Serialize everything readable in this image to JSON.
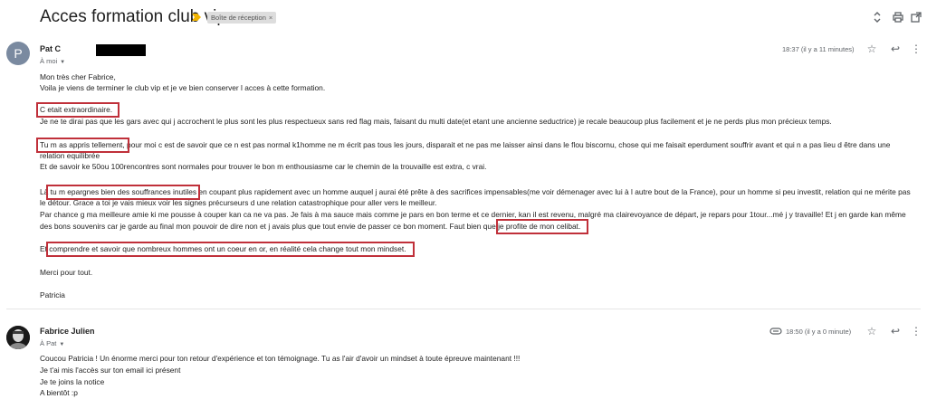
{
  "subject": {
    "title": "Acces formation club vip",
    "label": "Boîte de réception",
    "label_close": "×"
  },
  "toolbar": {
    "expand_icon": "⇳",
    "print_icon": "⎙",
    "open_icon": "⧉"
  },
  "message1": {
    "avatar_letter": "P",
    "sender": "Pat C",
    "recipient": "À moi",
    "time": "18:37 (il y a 11 minutes)",
    "lines": [
      "Mon très cher Fabrice,",
      "Voila je viens de terminer le club vip et je ve bien conserver l acces à cette formation.",
      "C etait extraordinaire.",
      "Je ne te dirai pas que les gars avec qui j accrochent le plus sont les plus respectueux sans red flag mais, faisant du multi date(et etant une ancienne seductrice) je recale beaucoup plus facilement et je ne perds plus mon précieux temps.",
      "Tu m as appris tellement, pour moi c est de savoir que ce n est pas normal k1homme ne m écrit pas tous les jours, disparait et ne pas me laisser ainsi dans le flou biscornu, chose qui me faisait eperdument souffrir avant et qui n a pas lieu d être dans une",
      "relation equilibrée",
      "Et de savoir ke 50ou 100rencontres sont normales pour trouver le bon m enthousiasme car le chemin de la trouvaille est extra, c vrai.",
      "Là tu m epargnes bien des souffrances inutiles en coupant plus rapidement avec un homme auquel j aurai été prête à des sacrifices impensables(me voir démenager avec lui à l autre bout de la France), pour un homme si peu investit, relation qui ne mérite pas",
      "le détour. Grace a toi je vais mieux voir les signes précurseurs d une relation catastrophique pour aller vers le meilleur.",
      "Par chance g ma meilleure amie ki me pousse à couper kan ca ne va pas. Je fais à ma sauce mais comme je pars en bon terme et ce dernier, kan il est revenu, malgré ma clairevoyance de départ, je repars pour 1tour...mé j y travaille! Et j en garde kan même",
      "des bons souvenirs car je garde au final mon pouvoir de dire non et j avais plus que tout envie de passer ce bon moment. Faut bien que je profite de mon celibat.",
      "Et comprendre et savoir que nombreux hommes ont un coeur en or, en réalité cela change tout mon mindset.",
      "Merci pour tout.",
      "Patricia"
    ]
  },
  "message2": {
    "sender": "Fabrice Julien",
    "recipient": "À Pat",
    "time": "18:50 (il y a 0 minute)",
    "lines": [
      "Coucou Patricia ! Un énorme merci pour ton retour d'expérience et ton témoignage. Tu as l'air d'avoir un mindset à toute épreuve maintenant !!!",
      "Je t'ai mis l'accès sur ton email ici présent",
      "Je te joins la notice",
      "A bientôt :p"
    ]
  },
  "actions": {
    "star_icon": "☆",
    "reply_icon": "↩",
    "more_icon": "⋮",
    "attachment_icon": "▭"
  }
}
